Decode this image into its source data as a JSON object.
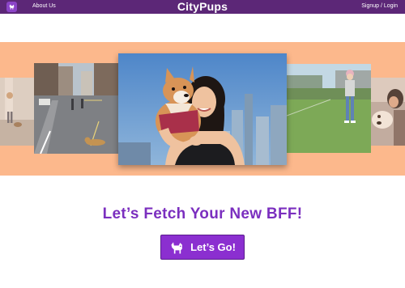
{
  "header": {
    "home_icon": "dog-icon",
    "about_label": "About Us",
    "brand": "CityPups",
    "auth_label": "Signup / Login"
  },
  "carousel": {
    "photos": [
      {
        "name": "photo-dog-walker-street-edge"
      },
      {
        "name": "photo-city-street-dog"
      },
      {
        "name": "photo-woman-hugging-shiba"
      },
      {
        "name": "photo-child-park"
      },
      {
        "name": "photo-dog-owner-edge"
      }
    ]
  },
  "hero": {
    "headline": "Let’s Fetch Your New BFF!",
    "cta_label": "Let’s Go!",
    "cta_icon": "dog-icon"
  },
  "colors": {
    "header_bg": "#5c2777",
    "band_bg": "#fcb88c",
    "accent": "#7b2fbf",
    "button_bg": "#8b2fd0"
  }
}
